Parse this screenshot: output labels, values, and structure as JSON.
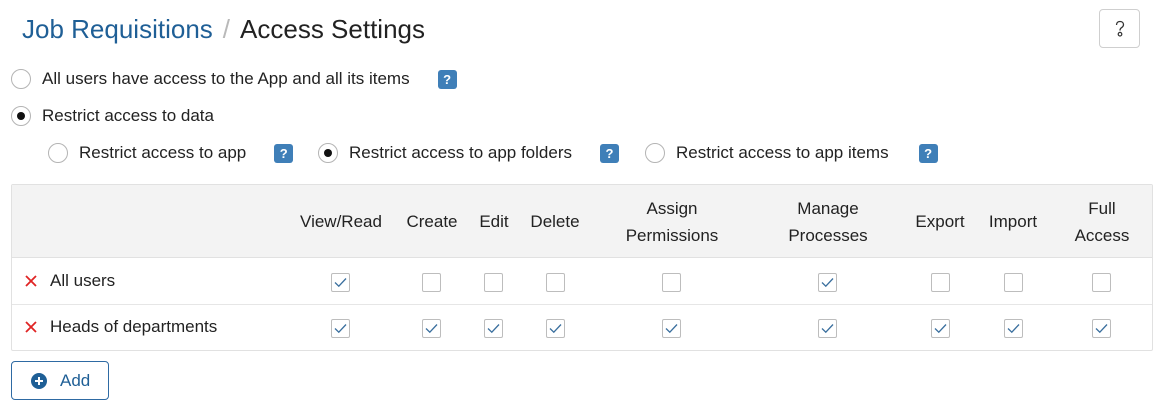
{
  "breadcrumb": {
    "parent": "Job Requisitions",
    "separator": "/",
    "current": "Access Settings"
  },
  "help_button": {
    "icon": "question-mark-icon"
  },
  "access_modes": [
    {
      "label": "All users have access to the App and all its items",
      "checked": false
    },
    {
      "label": "Restrict access to data",
      "checked": true
    }
  ],
  "restrict_modes": [
    {
      "label": "Restrict access to app",
      "checked": false
    },
    {
      "label": "Restrict access to app folders",
      "checked": true
    },
    {
      "label": "Restrict access to app items",
      "checked": false
    }
  ],
  "help_badge": "?",
  "table": {
    "columns": [
      "View/Read",
      "Create",
      "Edit",
      "Delete",
      "Assign Permissions",
      "Manage Processes",
      "Export",
      "Import",
      "Full Access"
    ],
    "rows": [
      {
        "name": "All users",
        "permissions": [
          true,
          false,
          false,
          false,
          false,
          true,
          false,
          false,
          false
        ]
      },
      {
        "name": "Heads of departments",
        "permissions": [
          true,
          true,
          true,
          true,
          true,
          true,
          true,
          true,
          true
        ]
      }
    ]
  },
  "add_button": {
    "label": "Add",
    "icon": "plus-circle-icon"
  },
  "colors": {
    "link": "#1f5f96",
    "badge": "#3f7fb8",
    "remove": "#e02424",
    "check": "#3a6f9e"
  }
}
